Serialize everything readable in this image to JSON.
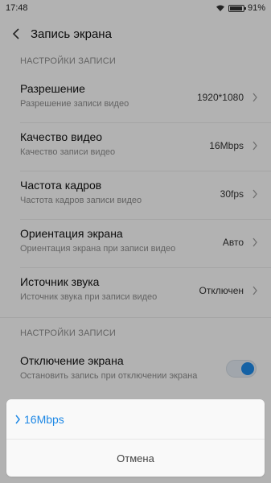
{
  "status_bar": {
    "time": "17:48",
    "battery_percent": "91%",
    "battery_level": 0.91,
    "icons": [
      "wifi-icon",
      "battery-icon"
    ]
  },
  "header": {
    "title": "Запись экрана",
    "back_icon": "chevron-left-icon"
  },
  "sections": [
    {
      "header": "НАСТРОЙКИ ЗАПИСИ",
      "items": [
        {
          "title": "Разрешение",
          "subtitle": "Разрешение записи видео",
          "value": "1920*1080"
        },
        {
          "title": "Качество видео",
          "subtitle": "Качество записи видео",
          "value": "16Mbps"
        },
        {
          "title": "Частота кадров",
          "subtitle": "Частота кадров записи видео",
          "value": "30fps"
        },
        {
          "title": "Ориентация экрана",
          "subtitle": "Ориентация экрана при записи видео",
          "value": "Авто"
        },
        {
          "title": "Источник звука",
          "subtitle": "Источник звука при записи видео",
          "value": "Отключен"
        }
      ]
    },
    {
      "header": "НАСТРОЙКИ ЗАПИСИ",
      "items": [
        {
          "title": "Отключение экрана",
          "subtitle": "Остановить запись при отключении экрана",
          "toggle_on": true
        }
      ]
    }
  ],
  "dialog": {
    "selected_option": "16Mbps",
    "cancel_label": "Отмена",
    "accent_color": "#1e88e5"
  }
}
